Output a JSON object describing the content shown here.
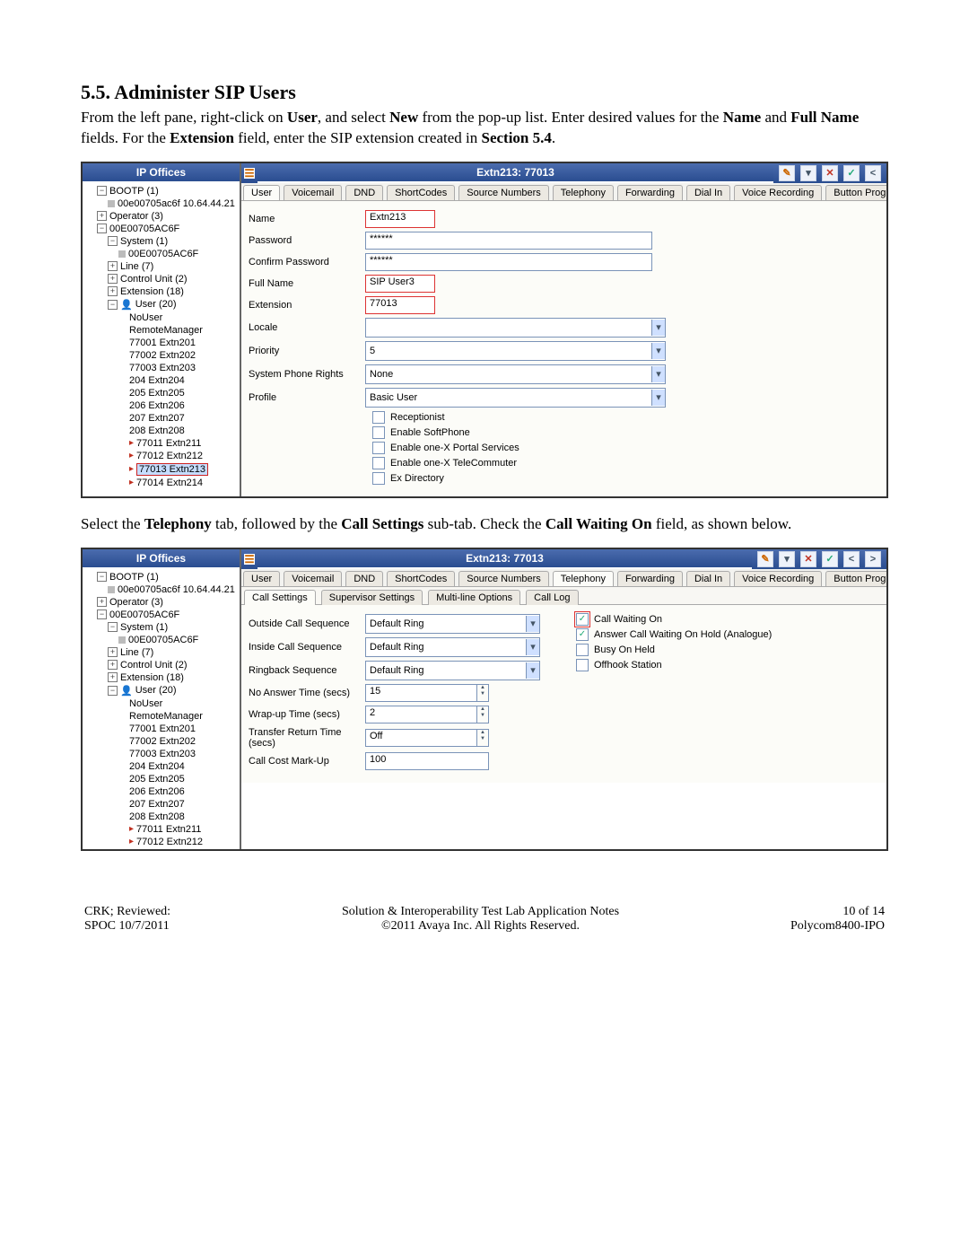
{
  "doc": {
    "heading": "5.5. Administer SIP Users",
    "para1_a": "From the left pane, right-click on ",
    "para1_b": ", and select ",
    "para1_c": " from the pop-up list.  Enter desired values for the ",
    "para1_d": " and ",
    "para1_e": " fields.  For the ",
    "para1_f": " field, enter the SIP extension created in ",
    "para1_g": ".",
    "bold_user": "User",
    "bold_new": "New",
    "bold_name": "Name",
    "bold_fullname": "Full Name",
    "bold_extension": "Extension",
    "bold_section54": "Section 5.4",
    "para2_a": "Select the ",
    "para2_b": " tab, followed by the ",
    "para2_c": " sub-tab.  Check the ",
    "para2_d": " field, as shown below.",
    "bold_telephony": "Telephony",
    "bold_callsettings": "Call Settings",
    "bold_callwaiting": "Call Waiting On"
  },
  "common": {
    "left_title": "IP Offices",
    "right_title": "Extn213: 77013",
    "tree": {
      "bootp": "BOOTP (1)",
      "mac": "00e00705ac6f 10.64.44.21",
      "operator": "Operator (3)",
      "root_mac": "00E00705AC6F",
      "system": "System (1)",
      "sys_mac": "00E00705AC6F",
      "line": "Line (7)",
      "control": "Control Unit (2)",
      "extension": "Extension (18)",
      "user": "User (20)",
      "nouser": "NoUser",
      "remote": "RemoteManager",
      "u201": "77001 Extn201",
      "u202": "77002 Extn202",
      "u203": "77003 Extn203",
      "u204": "204 Extn204",
      "u205": "205 Extn205",
      "u206": "206 Extn206",
      "u207": "207 Extn207",
      "u208": "208 Extn208",
      "u211": "77011 Extn211",
      "u212": "77012 Extn212",
      "u213": "77013 Extn213",
      "u214": "77014 Extn214"
    },
    "tabs": [
      "User",
      "Voicemail",
      "DND",
      "ShortCodes",
      "Source Numbers",
      "Telephony",
      "Forwarding",
      "Dial In",
      "Voice Recording",
      "Button Prog"
    ],
    "subtabs": [
      "Call Settings",
      "Supervisor Settings",
      "Multi-line Options",
      "Call Log"
    ]
  },
  "form1": {
    "labels": {
      "name": "Name",
      "password": "Password",
      "confirm": "Confirm Password",
      "fullname": "Full Name",
      "extension": "Extension",
      "locale": "Locale",
      "priority": "Priority",
      "rights": "System Phone Rights",
      "profile": "Profile"
    },
    "values": {
      "name": "Extn213",
      "password": "******",
      "confirm": "******",
      "fullname": "SIP User3",
      "extension": "77013",
      "locale": "",
      "priority": "5",
      "rights": "None",
      "profile": "Basic User"
    },
    "checks": {
      "receptionist": "Receptionist",
      "softphone": "Enable SoftPhone",
      "portal": "Enable one-X Portal Services",
      "tele": "Enable one-X TeleCommuter",
      "exdir": "Ex Directory"
    }
  },
  "form2": {
    "labels": {
      "outside": "Outside Call Sequence",
      "inside": "Inside Call Sequence",
      "ringback": "Ringback Sequence",
      "noanswer": "No Answer Time (secs)",
      "wrapup": "Wrap-up Time (secs)",
      "transfer": "Transfer Return Time (secs)",
      "cost": "Call Cost Mark-Up"
    },
    "values": {
      "outside": "Default Ring",
      "inside": "Default Ring",
      "ringback": "Default Ring",
      "noanswer": "15",
      "wrapup": "2",
      "transfer": "Off",
      "cost": "100"
    },
    "rightchecks": {
      "callwaiting": "Call Waiting On",
      "answerhold": "Answer Call Waiting On Hold (Analogue)",
      "busy": "Busy On Held",
      "offhook": "Offhook Station"
    }
  },
  "footer": {
    "left1": "CRK; Reviewed:",
    "left2": "SPOC 10/7/2011",
    "mid1": "Solution & Interoperability Test Lab Application Notes",
    "mid2": "©2011 Avaya Inc. All Rights Reserved.",
    "right1": "10 of 14",
    "right2": "Polycom8400-IPO"
  }
}
